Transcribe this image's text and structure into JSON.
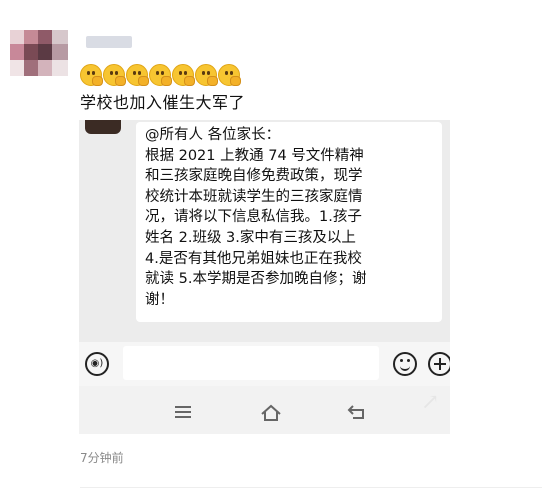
{
  "post": {
    "caption": "学校也加入催生大军了",
    "emoji_count": 7,
    "timestamp": "7分钟前"
  },
  "screenshot": {
    "message_lines": [
      "@所有人  各位家长：",
      "  根据 2021 上教通 74 号文件精神",
      "和三孩家庭晚自修免费政策，现学",
      "校统计本班就读学生的三孩家庭情",
      "况，请将以下信息私信我。1.孩子",
      "姓名 2.班级 3.家中有三孩及以上",
      "4.是否有其他兄弟姐妹也正在我校",
      "就读 5.本学期是否参加晚自修；谢",
      "谢！"
    ],
    "icons": [
      "voice-icon",
      "emoji-icon",
      "plus-icon",
      "menu-icon",
      "home-icon",
      "back-icon"
    ]
  }
}
